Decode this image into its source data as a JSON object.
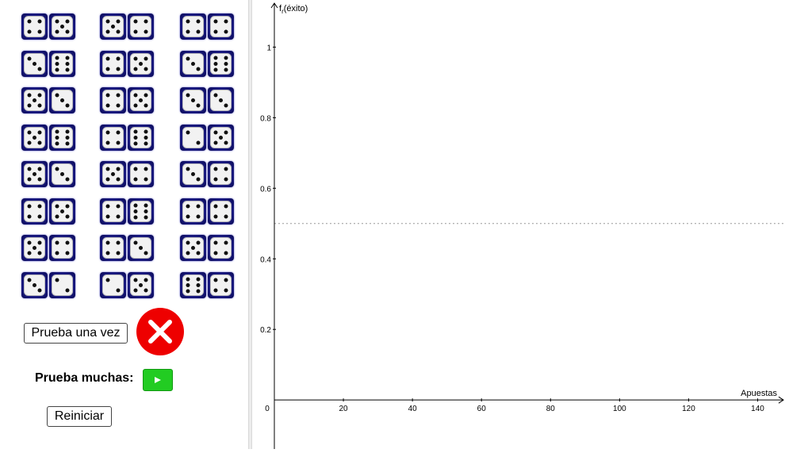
{
  "dice": [
    [
      4,
      5
    ],
    [
      5,
      4
    ],
    [
      4,
      4
    ],
    [
      3,
      6
    ],
    [
      4,
      5
    ],
    [
      3,
      6
    ],
    [
      5,
      3
    ],
    [
      4,
      5
    ],
    [
      3,
      3
    ],
    [
      5,
      6
    ],
    [
      4,
      6
    ],
    [
      2,
      5
    ],
    [
      5,
      3
    ],
    [
      5,
      4
    ],
    [
      3,
      4
    ],
    [
      4,
      5
    ],
    [
      4,
      6
    ],
    [
      4,
      4
    ],
    [
      5,
      4
    ],
    [
      4,
      3
    ],
    [
      5,
      4
    ],
    [
      3,
      2
    ],
    [
      2,
      5
    ],
    [
      6,
      4
    ]
  ],
  "controls": {
    "once_label": "Prueba una vez",
    "many_label": "Prueba muchas:",
    "reset_label": "Reiniciar",
    "result": "fallo",
    "result_color": "#ee0000",
    "play_color": "#22cc22"
  },
  "chart_data": {
    "type": "line",
    "xlabel": "Apuestas",
    "ylabel_main": "f",
    "ylabel_sub": "r",
    "ylabel_rest": "(éxito)",
    "xlim": [
      0,
      147
    ],
    "ylim": [
      -0.13,
      1.12
    ],
    "x_ticks": [
      20,
      40,
      60,
      80,
      100,
      120,
      140
    ],
    "y_ticks": [
      0.2,
      0.4,
      0.6,
      0.8,
      1
    ],
    "origin_label": "0",
    "reference_line_y": 0.5,
    "series": []
  }
}
